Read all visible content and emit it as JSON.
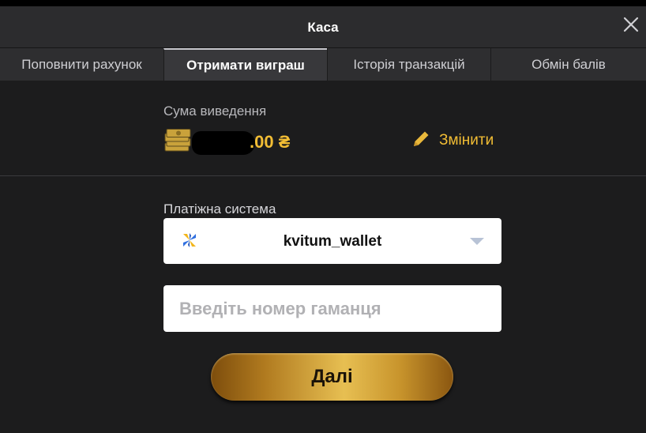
{
  "modal": {
    "title": "Каса",
    "close_icon": "close-icon"
  },
  "tabs": [
    {
      "label": "Поповнити рахунок",
      "active": false
    },
    {
      "label": "Отримати виграш",
      "active": true
    },
    {
      "label": "Історія транзакцій",
      "active": false
    },
    {
      "label": "Обмін балів",
      "active": false
    }
  ],
  "withdrawal": {
    "sum_label": "Сума виведення",
    "amount_suffix": ".00 ₴",
    "amount_icon": "money-stack-icon",
    "change_label": "Змінити",
    "change_icon": "pencil-icon"
  },
  "payment": {
    "label": "Платіжна система",
    "selected": "kvitum_wallet",
    "selected_icon": "kvitum-wallet-icon",
    "wallet_placeholder": "Введіть номер гаманця",
    "wallet_value": ""
  },
  "actions": {
    "next_label": "Далі"
  },
  "colors": {
    "accent": "#f2bd34",
    "background": "#1c1c1d",
    "header": "#2c2c2e"
  }
}
